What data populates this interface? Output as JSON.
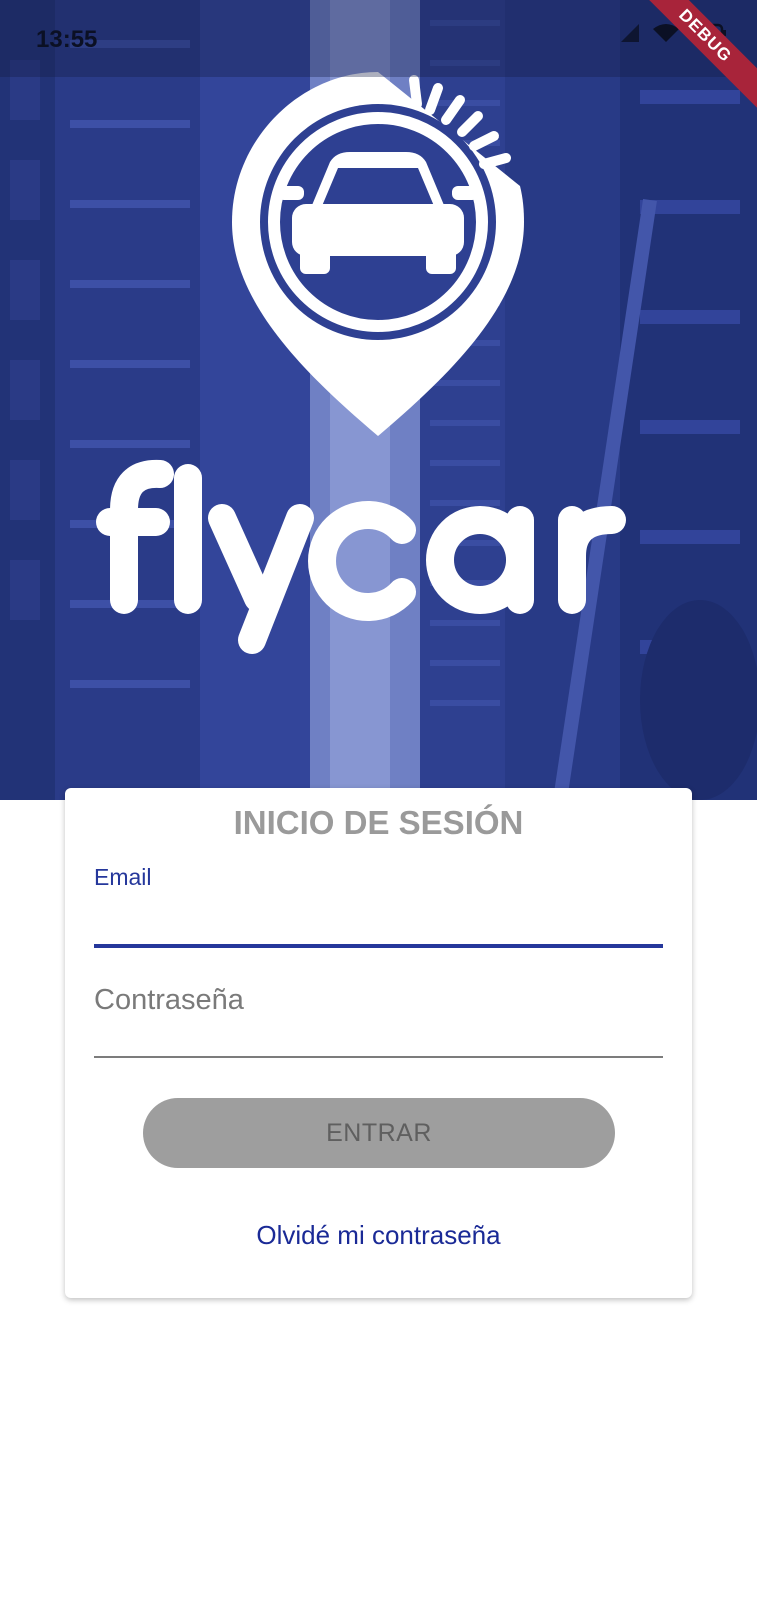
{
  "status_bar": {
    "time": "13:55",
    "icons": [
      "signal-icon",
      "wifi-icon",
      "battery-icon"
    ]
  },
  "debug_banner": "DEBUG",
  "brand": {
    "name": "flycar"
  },
  "login": {
    "title": "INICIO DE SESIÓN",
    "email_label": "Email",
    "email_value": "",
    "password_placeholder": "Contraseña",
    "submit_label": "ENTRAR",
    "forgot_label": "Olvidé mi contraseña"
  },
  "colors": {
    "hero_overlay": "#2b3b8e",
    "accent": "#25379b",
    "link": "#1a2a96",
    "button_disabled": "#9e9e9e",
    "debug_banner": "#a8243a"
  }
}
